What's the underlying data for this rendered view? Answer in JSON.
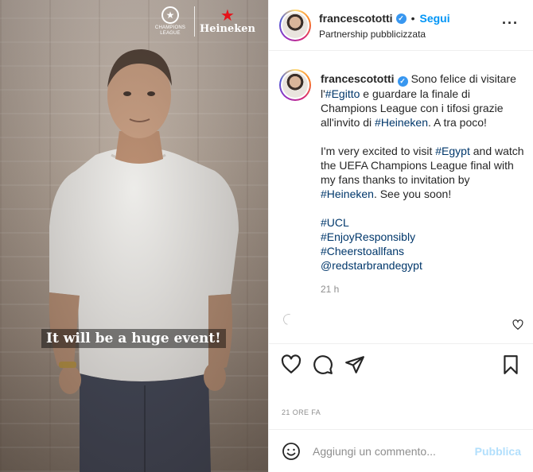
{
  "media": {
    "caption": "It will be a huge event!",
    "brand_ucl_text": "CHAMPIONS LEAGUE",
    "brand_heineken": "Heineken"
  },
  "header": {
    "username": "francescototti",
    "separator": "•",
    "follow_label": "Segui",
    "subtitle": "Partnership pubblicizzata",
    "more_icon": "more-horizontal-icon"
  },
  "post": {
    "username": "francescototti",
    "italian": {
      "pre": "Sono felice di visitare l'",
      "tag1": "#Egitto",
      "mid": " e guardare la finale di Champions League con i tifosi grazie all'invito di ",
      "tag2": "#Heineken",
      "post": ". A tra poco!"
    },
    "english": {
      "pre": "I'm very excited to visit ",
      "tag1": "#Egypt",
      "mid": " and watch the UEFA Champions League final with my fans thanks to invitation by ",
      "tag2": "#Heineken",
      "post": ". See you soon!"
    },
    "tags": [
      "#UCL",
      "#EnjoyResponsibly",
      "#Cheerstoallfans",
      "@redstarbrandegypt"
    ],
    "time": "21 h"
  },
  "date_label": "21 ORE FA",
  "comment_box": {
    "placeholder": "Aggiungi un commento...",
    "publish_label": "Pubblica"
  },
  "colors": {
    "accent": "#0095f6",
    "link": "#00376b",
    "muted": "#8e8e8e",
    "verified": "#3897f0"
  }
}
